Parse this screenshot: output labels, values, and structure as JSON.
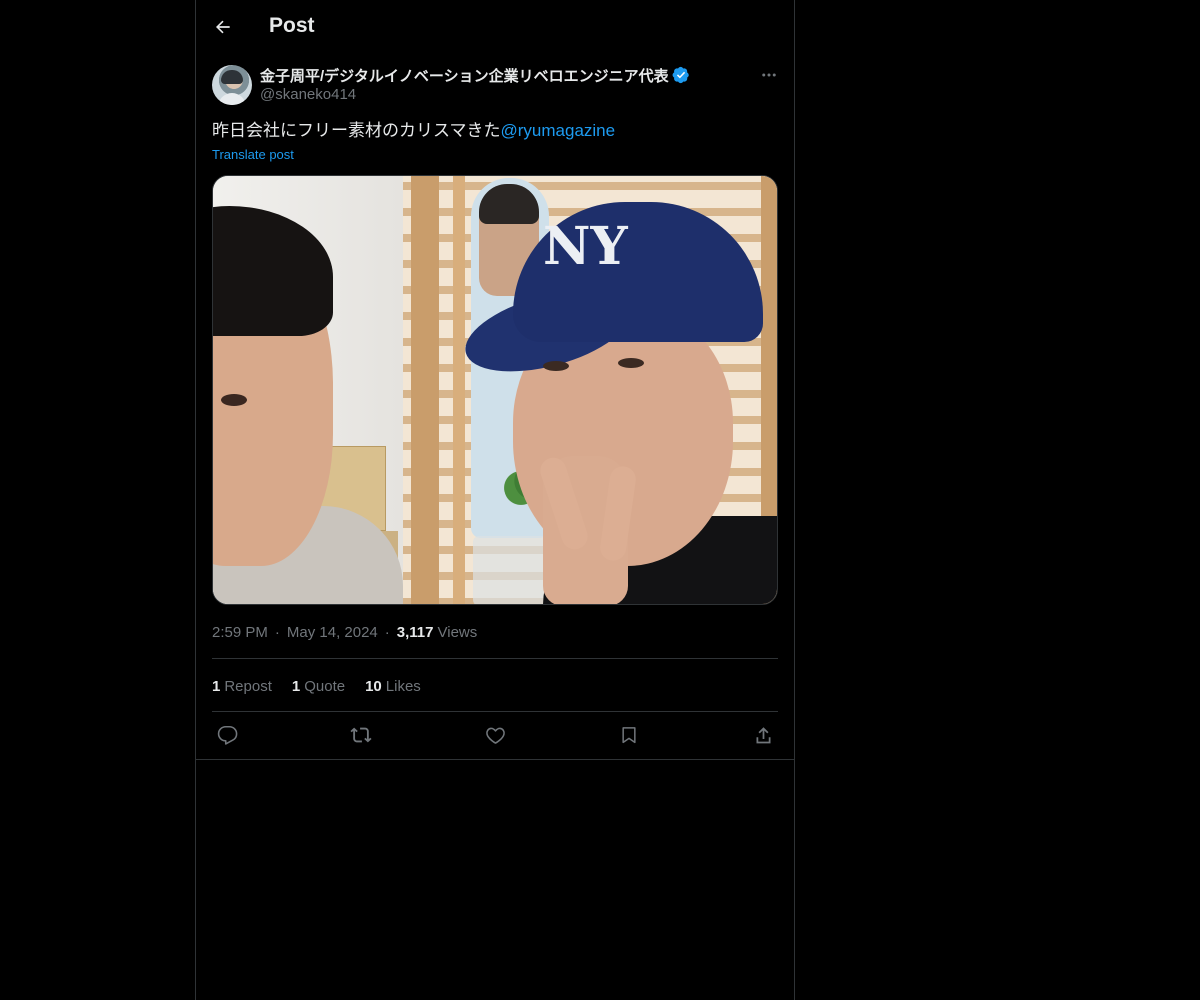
{
  "header": {
    "title": "Post",
    "back_icon": "arrow-left-icon"
  },
  "author": {
    "display_name": "金子周平/デジタルイノベーション企業リベロエンジニア代表",
    "handle": "@skaneko414",
    "verified": true,
    "verified_color": "#1d9bf0"
  },
  "post": {
    "text": "昨日会社にフリー素材のカリスマきた",
    "mention": "@ryumagazine",
    "translate_label": "Translate post",
    "time": "2:59 PM",
    "separator": "·",
    "date": "May 14, 2024",
    "views_count": "3,117",
    "views_label": "Views"
  },
  "stats": {
    "reposts_count": "1",
    "reposts_label": "Repost",
    "quotes_count": "1",
    "quotes_label": "Quote",
    "likes_count": "10",
    "likes_label": "Likes"
  },
  "actions": [
    "reply-icon",
    "repost-icon",
    "like-icon",
    "bookmark-icon",
    "share-icon"
  ],
  "colors": {
    "background": "#000000",
    "text": "#e7e9ea",
    "secondary_text": "#71767b",
    "accent": "#1d9bf0",
    "border": "#2f3336"
  }
}
